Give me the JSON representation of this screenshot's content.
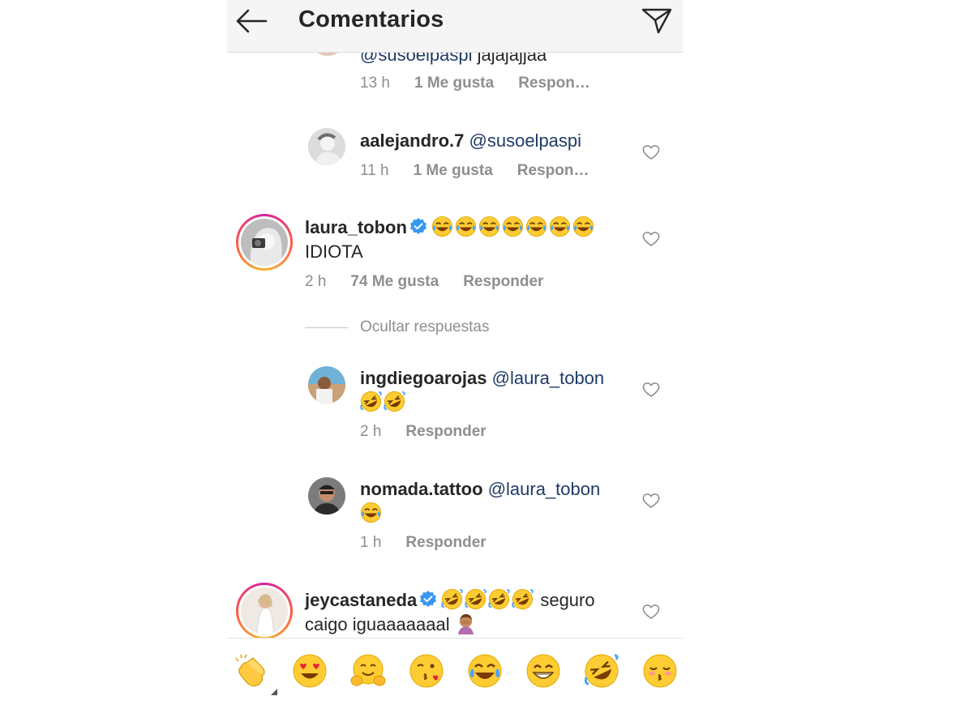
{
  "header": {
    "title": "Comentarios",
    "back_icon": "arrow-left-icon",
    "send_icon": "paper-plane-icon"
  },
  "comments": [
    {
      "id": "c0",
      "text_mention": "@susoelpaspi",
      "text": "jajajajjaa",
      "time": "13 h",
      "likes": "1 Me gusta",
      "reply": "Respon…"
    },
    {
      "id": "c1",
      "username": "aalejandro.7",
      "text_mention": "@susoelpaspi",
      "time": "11 h",
      "likes": "1 Me gusta",
      "reply": "Respon…"
    },
    {
      "id": "c2",
      "username": "laura_tobon",
      "verified": true,
      "emoji": "face-with-tears-of-joy x7",
      "text": "IDIOTA",
      "time": "2 h",
      "likes": "74 Me gusta",
      "reply": "Responder"
    },
    {
      "id": "c3",
      "username": "ingdiegoarojas",
      "text_mention": "@laura_tobon",
      "emoji": "rolling-on-floor-laughing x2",
      "time": "2 h",
      "reply": "Responder"
    },
    {
      "id": "c4",
      "username": "nomada.tattoo",
      "text_mention": "@laura_tobon",
      "emoji": "face-with-tears-of-joy x1",
      "time": "1 h",
      "reply": "Responder"
    },
    {
      "id": "c5",
      "username": "jeycastaneda",
      "verified": true,
      "emoji": "rolling-on-floor-laughing x4",
      "text": "seguro caigo iguaaaaaaal",
      "trailing_emoji": "person-facepalming"
    }
  ],
  "hide_replies": "Ocultar respuestas",
  "emoji_bar": [
    "clapping-hands",
    "heart-eyes",
    "hugging-face",
    "face-blowing-kiss",
    "face-with-tears-of-joy",
    "beaming-face",
    "rolling-on-floor-laughing",
    "kissing-face-closed-eyes"
  ],
  "colors": {
    "text": "#262626",
    "muted": "#8e8e8e",
    "mention": "#1f3b66",
    "verified": "#3897f0",
    "emoji": "#ffcc33"
  }
}
